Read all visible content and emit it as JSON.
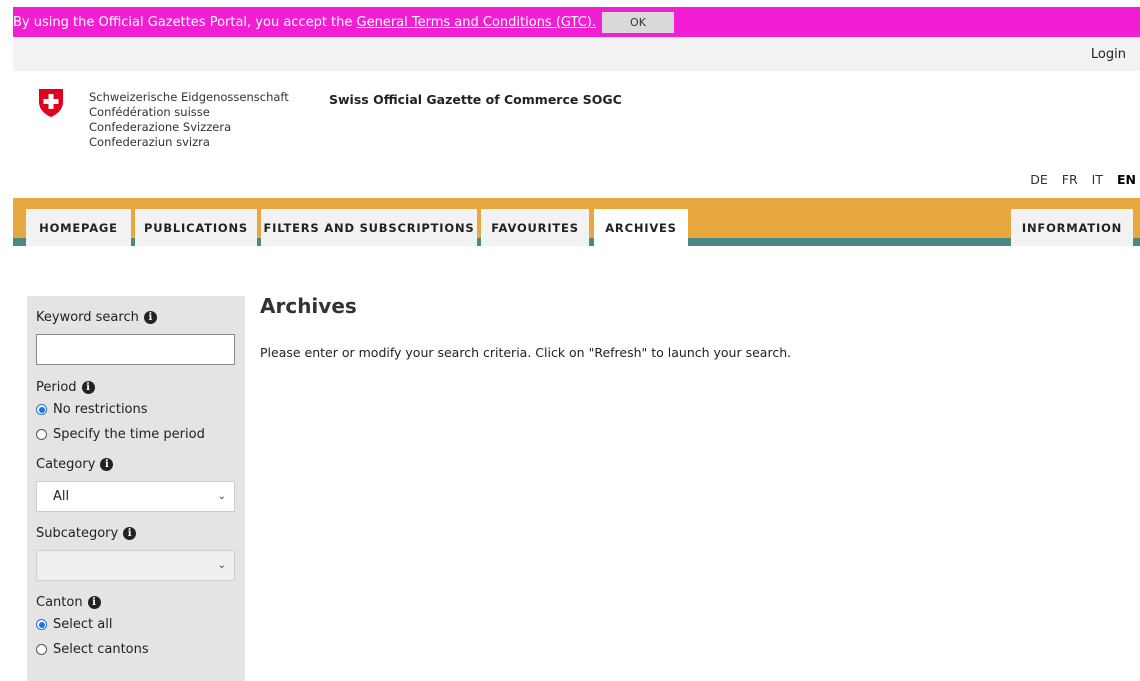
{
  "banner": {
    "text": "By using the Official Gazettes Portal, you accept the ",
    "link": "General Terms and Conditions (GTC).",
    "ok_label": "OK",
    "color": "#f21ed4"
  },
  "header": {
    "login": "Login",
    "confederation_lines": [
      "Schweizerische Eidgenossenschaft",
      "Confédération suisse",
      "Confederazione Svizzera",
      "Confederaziun svizra"
    ],
    "site_title": "Swiss Official Gazette of Commerce SOGC",
    "languages": [
      "DE",
      "FR",
      "IT",
      "EN"
    ],
    "active_language": "EN"
  },
  "nav": {
    "tabs": [
      {
        "label": "HOMEPAGE"
      },
      {
        "label": "PUBLICATIONS"
      },
      {
        "label": "FILTERS AND SUBSCRIPTIONS"
      },
      {
        "label": "FAVOURITES"
      },
      {
        "label": "ARCHIVES"
      },
      {
        "label": "INFORMATION"
      }
    ],
    "active": "ARCHIVES",
    "bar_color": "#e8a840",
    "accent_color": "#4a8a86"
  },
  "sidebar": {
    "keyword_label": "Keyword search",
    "keyword_value": "",
    "period_label": "Period",
    "period_options": [
      "No restrictions",
      "Specify the time period"
    ],
    "period_selected": "No restrictions",
    "category_label": "Category",
    "category_value": "All",
    "subcategory_label": "Subcategory",
    "subcategory_value": "",
    "canton_label": "Canton",
    "canton_options": [
      "Select all",
      "Select cantons"
    ],
    "canton_selected": "Select all",
    "info_icon": "info-icon"
  },
  "main": {
    "title": "Archives",
    "hint": "Please enter or modify your search criteria. Click on \"Refresh\" to launch your search."
  }
}
